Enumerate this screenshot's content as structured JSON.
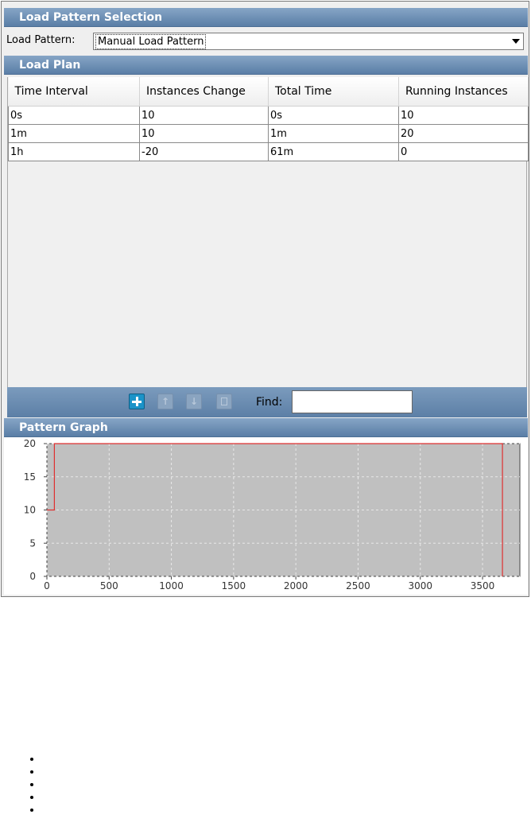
{
  "selection": {
    "header": "Load Pattern Selection",
    "label": "Load Pattern:",
    "value": "Manual Load Pattern"
  },
  "plan": {
    "header": "Load Plan",
    "columns": [
      "Time Interval",
      "Instances Change",
      "Total Time",
      "Running Instances"
    ],
    "rows": [
      [
        "0s",
        "10",
        "0s",
        "10"
      ],
      [
        "1m",
        "10",
        "1m",
        "20"
      ],
      [
        "1h",
        "-20",
        "61m",
        "0"
      ]
    ]
  },
  "toolbar": {
    "add_icon": "plus-icon",
    "up_icon": "arrow-up-icon",
    "down_icon": "arrow-down-icon",
    "delete_icon": "trash-icon",
    "find_label": "Find:",
    "find_value": ""
  },
  "graph": {
    "header": "Pattern Graph",
    "line_color": "#e03030",
    "plot_bg": "#c0c0c0"
  },
  "chart_data": {
    "type": "line",
    "x": [
      0,
      60,
      60,
      3660,
      3660
    ],
    "y": [
      10,
      10,
      20,
      20,
      0
    ],
    "xlim": [
      0,
      3800
    ],
    "ylim": [
      0,
      20
    ],
    "xticks": [
      0,
      500,
      1000,
      1500,
      2000,
      2500,
      3000,
      3500
    ],
    "yticks": [
      0,
      5,
      10,
      15,
      20
    ],
    "grid": true
  },
  "bullet_count": 5
}
